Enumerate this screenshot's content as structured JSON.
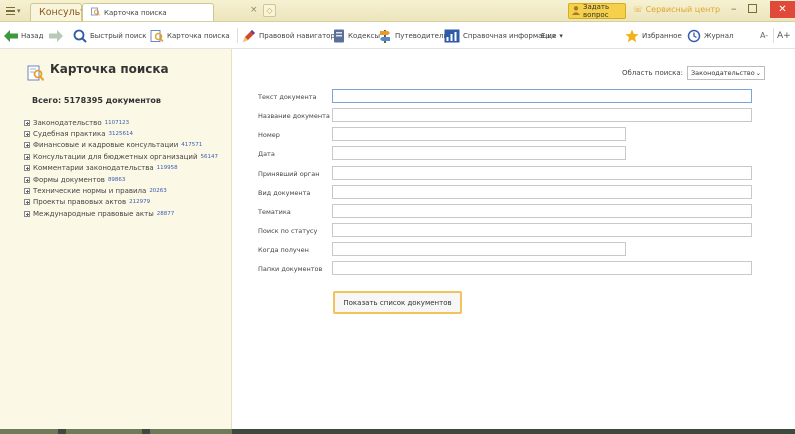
{
  "titlebar": {
    "app_tab": "КонсультантПлюс",
    "search_tab": "Карточка поиска",
    "close_tab": "×",
    "ask_button": "Задать вопрос",
    "service_center": "Сервисный центр",
    "minimize": "–",
    "close_window": "✕"
  },
  "toolbar": {
    "back": "Назад",
    "quick_search": "Быстрый поиск",
    "search_card": "Карточка поиска",
    "legal_navigator": "Правовой навигатор",
    "codes": "Кодексы",
    "guides": "Путеводители",
    "reference": "Справочная информация",
    "more": "Еще",
    "favorites": "Избранное",
    "journal": "Журнал",
    "font_smaller": "A-",
    "font_larger": "A+"
  },
  "left_panel": {
    "title": "Карточка поиска",
    "total": "Всего: 5178395 документов",
    "categories": [
      {
        "label": "Законодательство",
        "count": "1107123"
      },
      {
        "label": "Судебная практика",
        "count": "3125614"
      },
      {
        "label": "Финансовые и кадровые консультации",
        "count": "417571"
      },
      {
        "label": "Консультации для бюджетных организаций",
        "count": "56147"
      },
      {
        "label": "Комментарии законодательства",
        "count": "119958"
      },
      {
        "label": "Формы документов",
        "count": "89863"
      },
      {
        "label": "Технические нормы и правила",
        "count": "20263"
      },
      {
        "label": "Проекты правовых актов",
        "count": "212979"
      },
      {
        "label": "Международные правовые акты",
        "count": "28877"
      }
    ]
  },
  "form": {
    "scope_label": "Область поиска:",
    "scope_value": "Законодательство",
    "fields": [
      {
        "label": "Текст документа",
        "value": ""
      },
      {
        "label": "Название документа",
        "value": ""
      },
      {
        "label": "Номер",
        "value": ""
      },
      {
        "label": "Дата",
        "value": ""
      },
      {
        "label": "Принявший орган",
        "value": ""
      },
      {
        "label": "Вид документа",
        "value": ""
      },
      {
        "label": "Тематика",
        "value": ""
      },
      {
        "label": "Поиск по статусу",
        "value": ""
      },
      {
        "label": "Когда получен",
        "value": ""
      },
      {
        "label": "Папки документов",
        "value": ""
      }
    ],
    "show_button": "Показать список документов"
  },
  "colors": {
    "titlebar": "#f6f1d2",
    "left_panel": "#fbf8e6",
    "accent_yellow": "#f5d04a",
    "link_blue": "#3a5cb0",
    "button_border": "#f1c35a"
  }
}
